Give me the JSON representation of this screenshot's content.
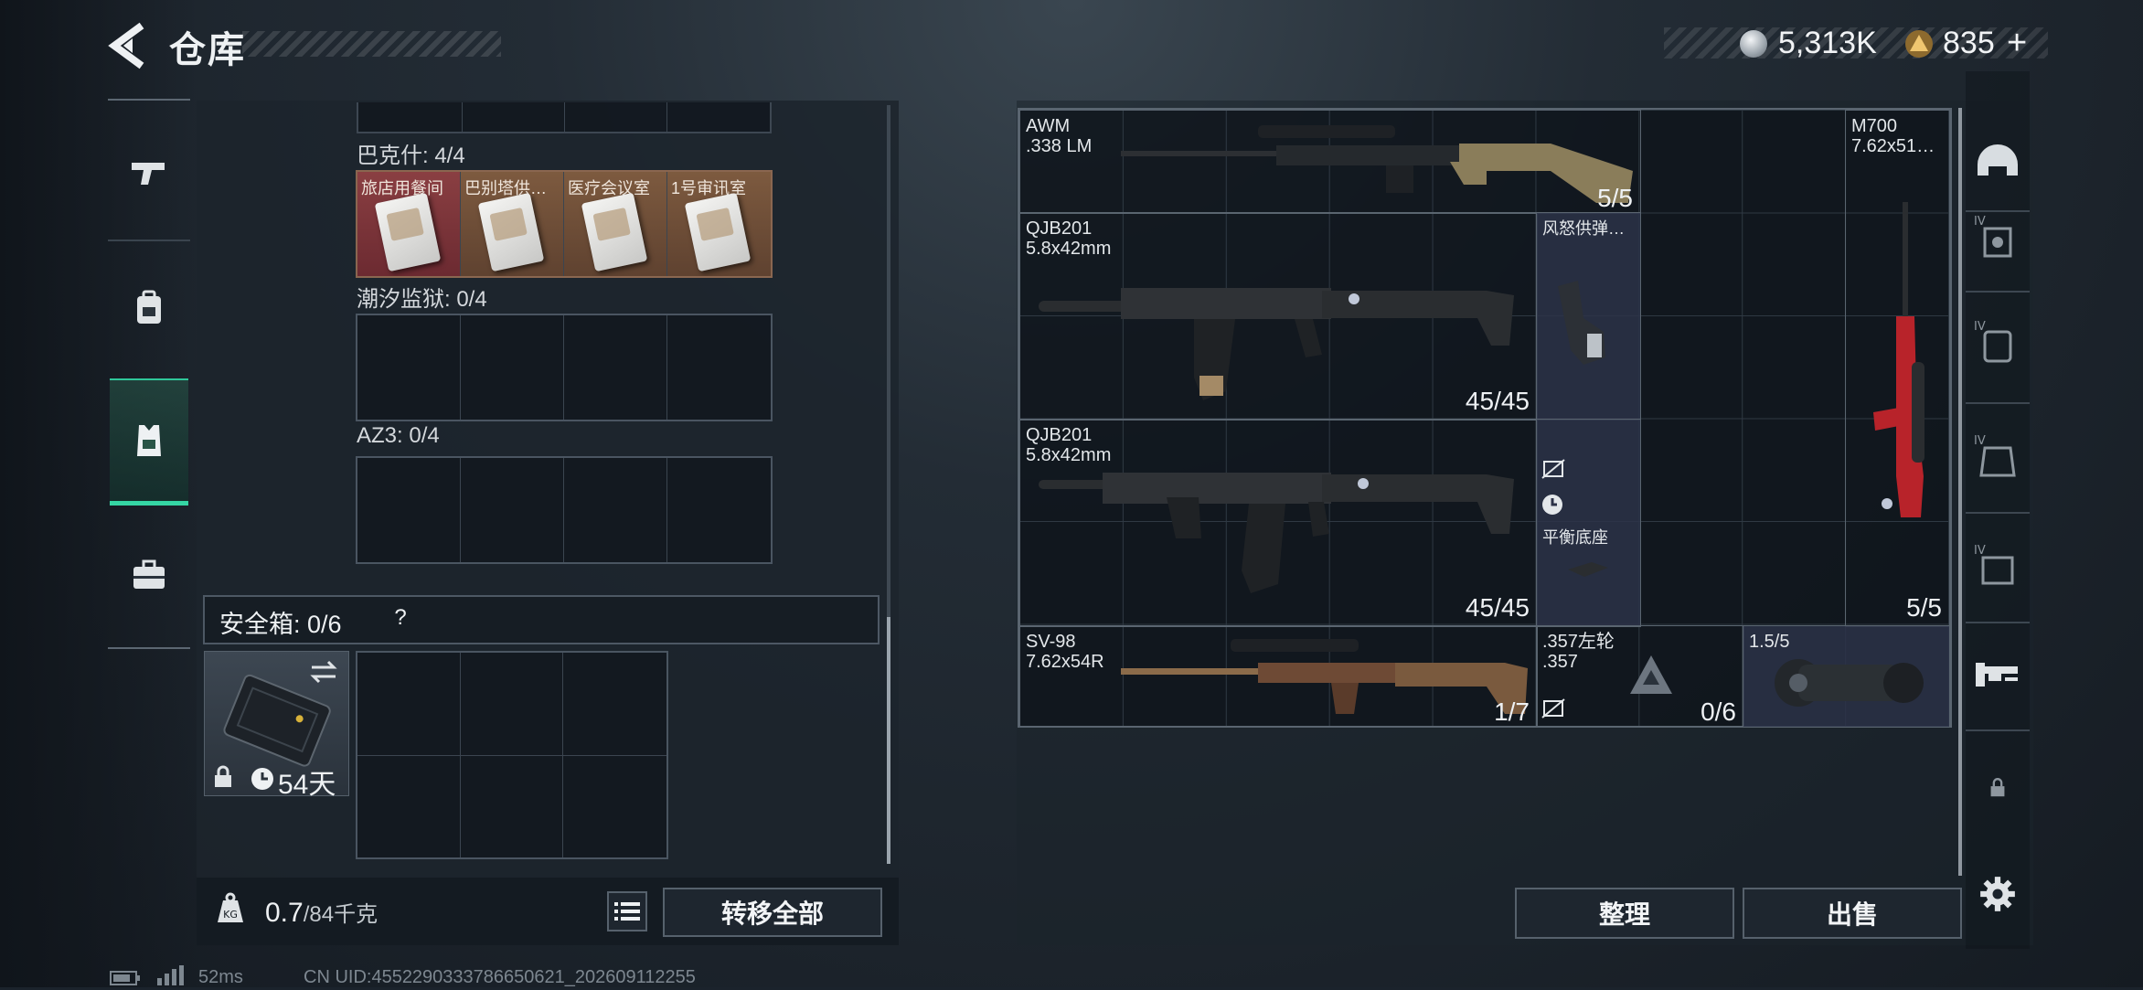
{
  "header": {
    "back_label": "<",
    "title": "仓库",
    "currency": [
      {
        "icon": "silver-coin-icon",
        "value": "5,313K"
      },
      {
        "icon": "gold-triangle-coin-icon",
        "value": "835"
      }
    ],
    "add_label": "+"
  },
  "left_nav": [
    {
      "icon": "pistol-icon",
      "active": false
    },
    {
      "icon": "backpack-icon",
      "active": false
    },
    {
      "icon": "vest-icon",
      "active": true
    },
    {
      "icon": "briefcase-icon",
      "active": false
    }
  ],
  "keycard_sections": [
    {
      "label": "巴克什: 4/4",
      "cards": [
        "旅店用餐间",
        "巴别塔供…",
        "医疗会议室",
        "1号审讯室"
      ]
    },
    {
      "label": "潮汐监狱: 0/4",
      "cards": []
    },
    {
      "label": "AZ3: 0/4",
      "cards": []
    }
  ],
  "safebox": {
    "label": "安全箱: 0/6",
    "help": "?",
    "days": "54天"
  },
  "footer": {
    "weight_value": "0.7",
    "weight_max": "/84千克",
    "transfer_all": "转移全部"
  },
  "stash_items": [
    {
      "name": "AWM\n.338 LM",
      "ammo": "5/5"
    },
    {
      "name": "QJB201\n5.8x42mm",
      "ammo": "45/45"
    },
    {
      "name": "QJB201\n5.8x42mm",
      "ammo": "45/45"
    },
    {
      "name": "M700\n7.62x51…",
      "ammo": "5/5"
    },
    {
      "name": "风怒供弹…",
      "ammo": ""
    },
    {
      "name": "平衡底座",
      "ammo": ""
    },
    {
      "name": "SV-98\n7.62x54R",
      "ammo": "1/7"
    },
    {
      "name": ".357左轮\n.357",
      "ammo": "0/6"
    },
    {
      "name": "1.5/5",
      "ammo": ""
    }
  ],
  "actions": {
    "sort": "整理",
    "sell": "出售"
  },
  "right_nav": [
    {
      "icon": "helmet-icon"
    },
    {
      "icon": "armor-tier-iv-icon",
      "tier": "IV"
    },
    {
      "icon": "backpack-tier-iv-icon",
      "tier": "IV"
    },
    {
      "icon": "rig-tier-iv-icon",
      "tier": "IV"
    },
    {
      "icon": "chest-tier-iv-icon",
      "tier": "IV"
    },
    {
      "icon": "sniper-rifle-icon"
    },
    {
      "icon": "lock-icon"
    },
    {
      "icon": "gear-icon"
    }
  ],
  "status_bar": {
    "ping": "52ms",
    "uid": "CN UID:4552290333786650621_202609112255"
  },
  "colors": {
    "accent_green": "#35d6a4",
    "keycard_bg": "#7a4b3c",
    "attachment_cell": "#2c3248"
  }
}
